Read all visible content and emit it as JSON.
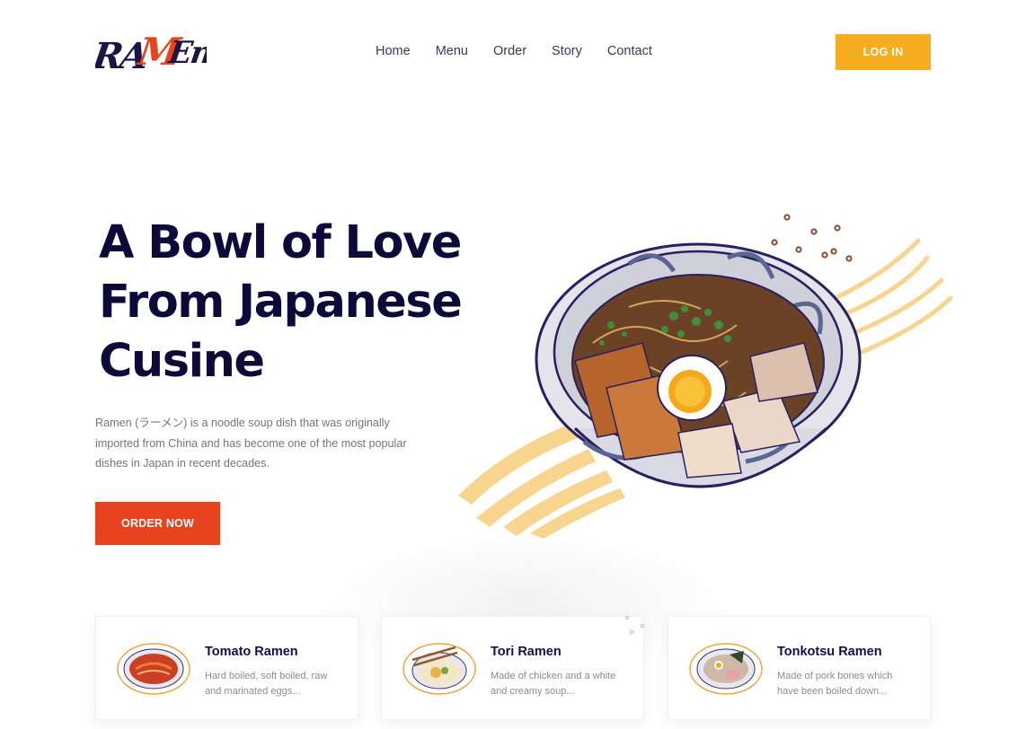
{
  "brand": {
    "logo_text": "RAMEN"
  },
  "nav": {
    "items": [
      "Home",
      "Menu",
      "Order",
      "Story",
      "Contact"
    ],
    "login_label": "LOG IN"
  },
  "hero": {
    "title_line1": "A Bowl of Love",
    "title_line2": "From Japanese",
    "title_line3": "Cusine",
    "description": "Ramen (ラーメン) is a noodle soup dish that was originally imported from China and has become one of the most popular dishes in Japan in recent decades.",
    "order_label": "ORDER NOW"
  },
  "cards": [
    {
      "title": "Tomato Ramen",
      "description": "Hard boiled, soft boiled, raw and marinated eggs..."
    },
    {
      "title": "Tori Ramen",
      "description": "Made of chicken and a white and creamy soup..."
    },
    {
      "title": "Tonkotsu Ramen",
      "description": "Made of pork bones which have been boiled down..."
    }
  ],
  "colors": {
    "accent_orange": "#e8431f",
    "accent_yellow": "#f6ad1f",
    "navy": "#0d0a3a"
  }
}
